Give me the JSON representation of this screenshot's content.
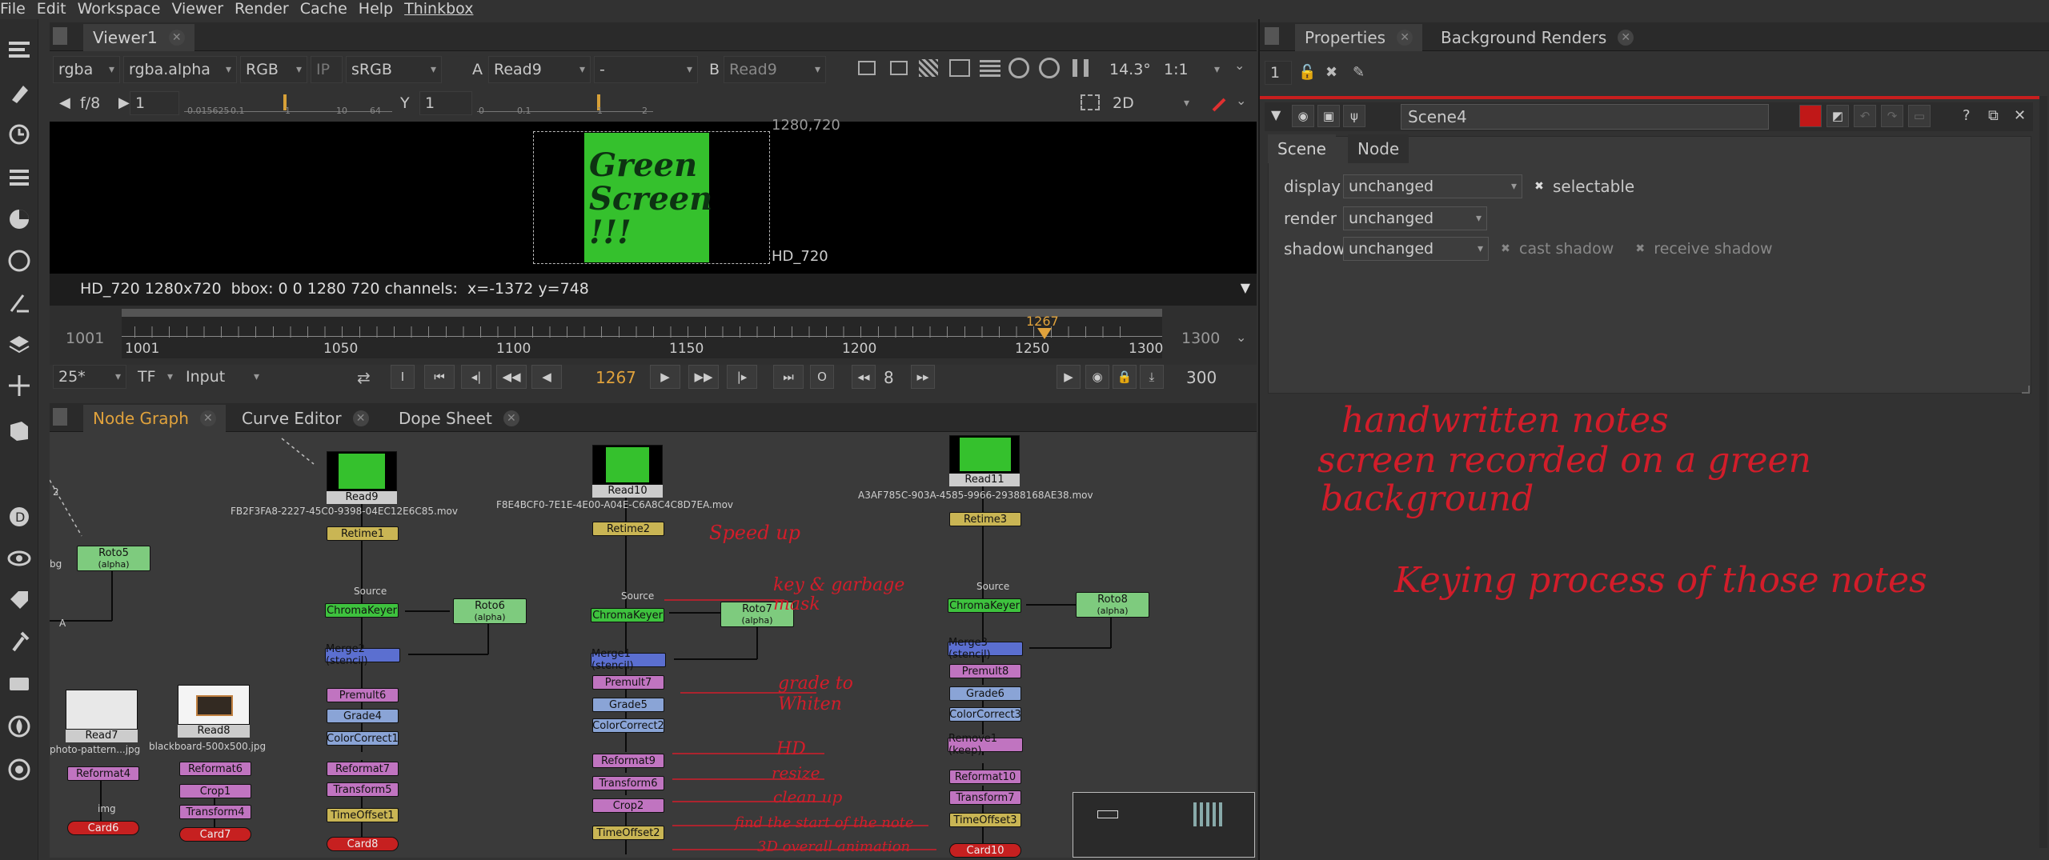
{
  "menu": [
    "File",
    "Edit",
    "Workspace",
    "Viewer",
    "Render",
    "Cache",
    "Help",
    "Thinkbox"
  ],
  "viewer": {
    "tab": "Viewer1",
    "channels": "rgba",
    "alpha": "rgba.alpha",
    "colorspace_rgb": "RGB",
    "ip": "IP",
    "lut": "sRGB",
    "a_label": "A",
    "a_input": "Read9",
    "blend": "-",
    "b_label": "B",
    "b_input": "Read9",
    "zoom": "14.3°",
    "ratio": "1:1",
    "fstop": "f/8",
    "gain": "1",
    "y_label": "Y",
    "gamma": "1",
    "view_mode": "2D",
    "format_top": "1280,720",
    "format_bottom": "HD_720",
    "image_text": "Green Screen !!!",
    "status": "HD_720 1280x720  bbox: 0 0 1280 720 channels:  x=-1372 y=748",
    "gain_ticks": [
      "0.015625",
      "0.1",
      "1",
      "10",
      "64"
    ],
    "gamma_ticks": [
      "0",
      "0.1",
      "1",
      "2"
    ]
  },
  "timeline": {
    "start": "1001",
    "end": "1300",
    "ticks": [
      "1001",
      "1050",
      "1100",
      "1150",
      "1200",
      "1250",
      "1300"
    ],
    "playhead": "1267",
    "fps": "25*",
    "tf": "TF",
    "input_mode": "Input",
    "current_frame": "1267",
    "step": "8",
    "frame_count": "300"
  },
  "nodegraph": {
    "tabs": [
      "Node Graph",
      "Curve Editor",
      "Dope Sheet"
    ],
    "column1": {
      "read": "Read9",
      "file": "FB2F3FA8-2227-45C0-9398-04EC12E6C85.mov",
      "retime": "Retime1",
      "source": "Source",
      "keyer": "ChromaKeyer",
      "roto": "Roto6",
      "roto_sub": "(alpha)",
      "merge": "Merge2 (stencil)",
      "nodes": [
        "Premult6",
        "Grade4",
        "ColorCorrect1",
        "Reformat7",
        "Transform5",
        "TimeOffset1"
      ],
      "card": "Card8"
    },
    "column2": {
      "read": "Read10",
      "file": "F8E4BCF0-7E1E-4E00-A04E-C6A8C4C8D7EA.mov",
      "retime": "Retime2",
      "source": "Source",
      "keyer": "ChromaKeyer",
      "roto": "Roto7",
      "roto_sub": "(alpha)",
      "merge": "Merge1 (stencil)",
      "nodes": [
        "Premult7",
        "Grade5",
        "ColorCorrect2",
        "Reformat9",
        "Transform6",
        "Crop2",
        "TimeOffset2"
      ]
    },
    "column3": {
      "read": "Read11",
      "file": "A3AF785C-903A-4585-9966-29388168AE38.mov",
      "retime": "Retime3",
      "source": "Source",
      "keyer": "ChromaKeyer",
      "roto": "Roto8",
      "roto_sub": "(alpha)",
      "merge": "Merge3 (stencil)",
      "nodes": [
        "Premult8",
        "Grade6",
        "ColorCorrect3",
        "Remove1 (keep)",
        "Reformat10",
        "Transform7",
        "TimeOffset3"
      ],
      "card": "Card10"
    },
    "left": {
      "roto": "Roto5",
      "roto_sub": "(alpha)",
      "read7": "Read7",
      "read7_file": "photo-pattern...jpg",
      "read8": "Read8",
      "read8_file": "blackboard-500x500.jpg",
      "reformat4": "Reformat4",
      "card6": "Card6",
      "read8_nodes": [
        "Reformat6",
        "Crop1",
        "Transform4"
      ],
      "card7": "Card7",
      "img": "img",
      "bg": "bg",
      "a": "A",
      "num2": "2"
    },
    "annotations": [
      "Speed up",
      "key & garbage mask",
      "grade to Whiten",
      "HD",
      "resize",
      "clean up",
      "find the start of the note",
      "3D overall animation"
    ]
  },
  "properties": {
    "tabs": [
      "Properties",
      "Background Renders"
    ],
    "max_panels": "1",
    "node_name": "Scene4",
    "subtabs": [
      "Scene",
      "Node"
    ],
    "display_label": "display",
    "display_value": "unchanged",
    "selectable": "selectable",
    "render_label": "render",
    "render_value": "unchanged",
    "shadow_label": "shadow",
    "shadow_value": "unchanged",
    "cast_shadow": "cast shadow",
    "receive_shadow": "receive shadow"
  },
  "notes": {
    "line1": "handwritten notes",
    "line2": "screen recorded on a green",
    "line3": "background",
    "line4": "Keying process of those notes"
  },
  "colors": {
    "accent": "#e0a23c",
    "handwriting": "#d21d2a",
    "green": "#3ec23e"
  }
}
